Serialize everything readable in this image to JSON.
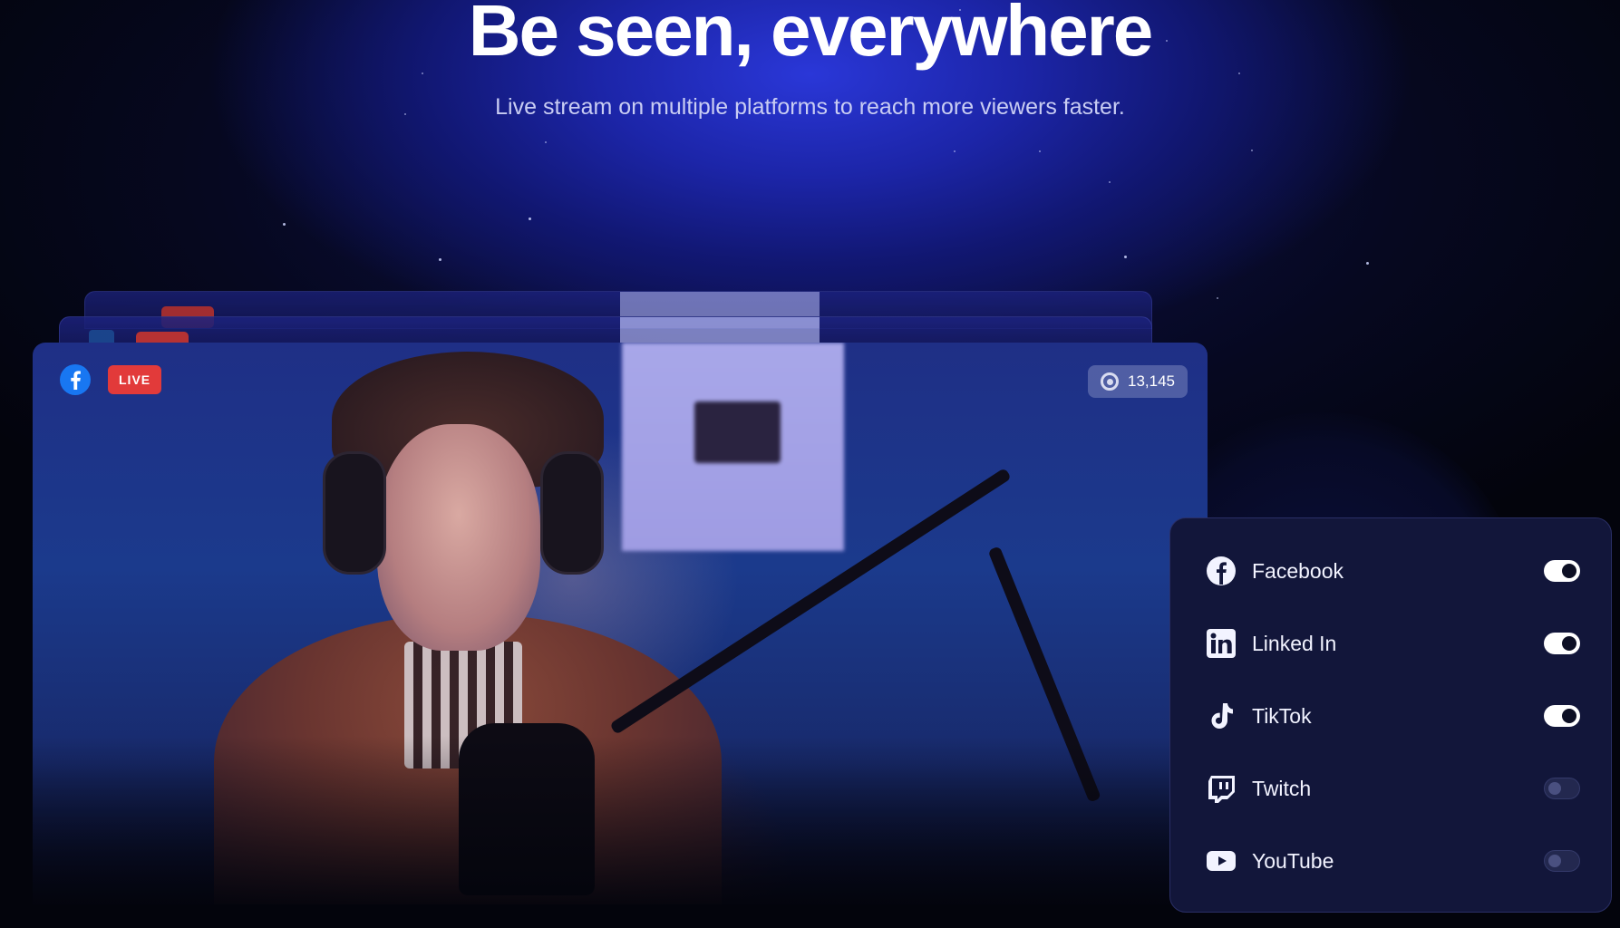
{
  "hero": {
    "title": "Be seen, everywhere",
    "subtitle": "Live stream on multiple platforms to reach more viewers faster."
  },
  "video": {
    "platform_icon": "facebook-icon",
    "live_label": "LIVE",
    "viewer_count": "13,145"
  },
  "platforms": [
    {
      "name": "Facebook",
      "icon": "facebook-icon",
      "enabled": true
    },
    {
      "name": "Linked In",
      "icon": "linkedin-icon",
      "enabled": true
    },
    {
      "name": "TikTok",
      "icon": "tiktok-icon",
      "enabled": true
    },
    {
      "name": "Twitch",
      "icon": "twitch-icon",
      "enabled": false
    },
    {
      "name": "YouTube",
      "icon": "youtube-icon",
      "enabled": false
    }
  ],
  "colors": {
    "live_badge": "#e23a3a",
    "facebook": "#1877f2",
    "panel_bg": "#12163a"
  }
}
